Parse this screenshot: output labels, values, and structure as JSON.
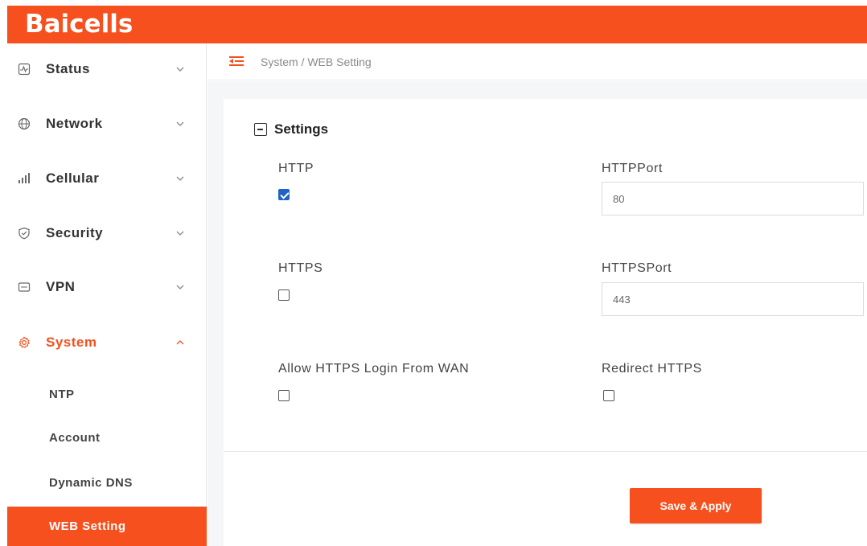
{
  "brand": {
    "logo_text": "Baicells",
    "accent_color": "#f5501e"
  },
  "sidebar": {
    "items": [
      {
        "label": "Status",
        "icon": "status-icon",
        "expanded": false
      },
      {
        "label": "Network",
        "icon": "network-icon",
        "expanded": false
      },
      {
        "label": "Cellular",
        "icon": "cellular-icon",
        "expanded": false
      },
      {
        "label": "Security",
        "icon": "shield-icon",
        "expanded": false
      },
      {
        "label": "VPN",
        "icon": "vpn-icon",
        "expanded": false
      },
      {
        "label": "System",
        "icon": "gear-icon",
        "expanded": true
      }
    ],
    "system_subitems": [
      {
        "label": "NTP",
        "selected": false
      },
      {
        "label": "Account",
        "selected": false
      },
      {
        "label": "Dynamic DNS",
        "selected": false
      },
      {
        "label": "WEB Setting",
        "selected": true
      }
    ]
  },
  "breadcrumb": {
    "text": "System / WEB Setting"
  },
  "settings": {
    "title": "Settings",
    "http_label": "HTTP",
    "http_checked": true,
    "http_port_label": "HTTPPort",
    "http_port_value": "80",
    "https_label": "HTTPS",
    "https_checked": false,
    "https_port_label": "HTTPSPort",
    "https_port_value": "443",
    "allow_wan_label": "Allow HTTPS Login From WAN",
    "allow_wan_checked": false,
    "redirect_https_label": "Redirect HTTPS",
    "redirect_https_checked": false
  },
  "actions": {
    "save_label": "Save & Apply"
  }
}
